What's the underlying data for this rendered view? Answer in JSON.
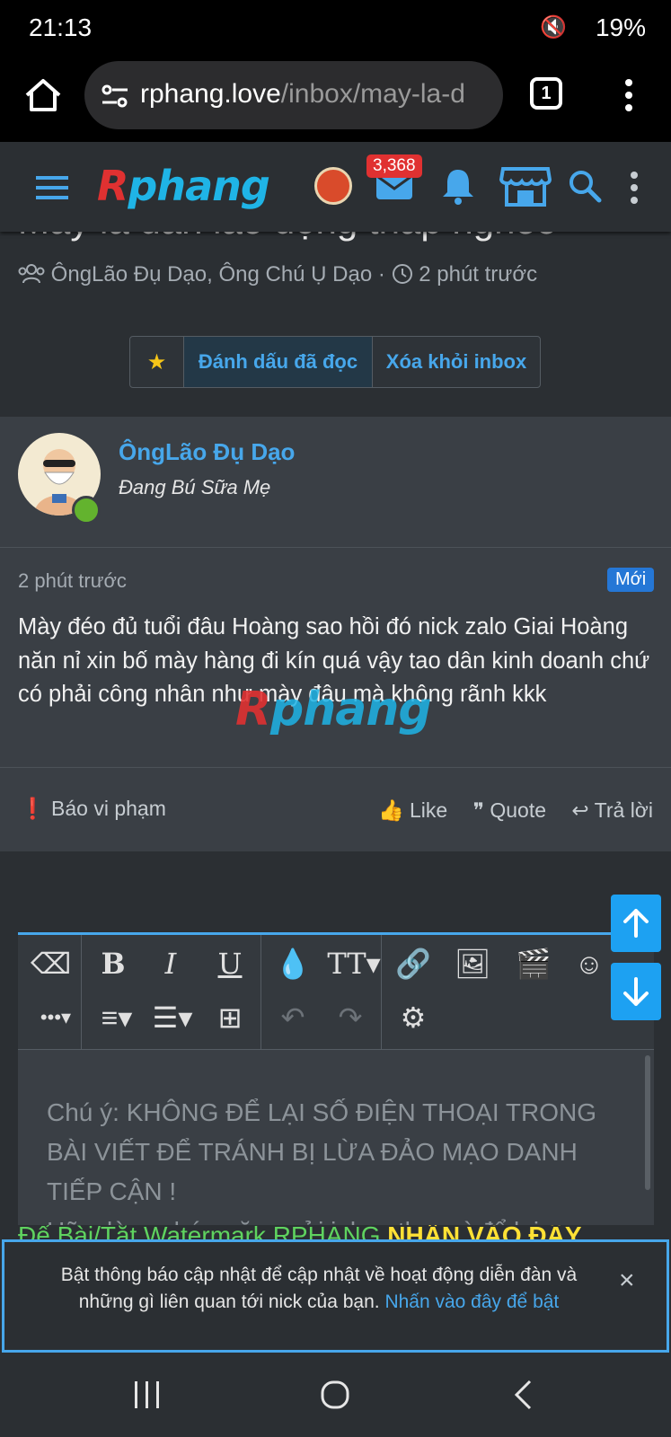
{
  "status": {
    "time": "21:13",
    "battery": "19%",
    "icons": [
      "mute-icon",
      "location-icon",
      "wifi-icon",
      "signal-icon",
      "volte-icon",
      "signal-icon"
    ]
  },
  "browser": {
    "url_domain": "rphang.love",
    "url_path": "/inbox/may-la-d",
    "tab_count": "1"
  },
  "header": {
    "logo": "Rphang",
    "inbox_badge": "3,368"
  },
  "thread": {
    "title": "Mày là dân lao động thấp nghèo",
    "participants": "ÔngLão Đụ Dạo, Ông Chú Ụ Dạo",
    "separator": "·",
    "time": "2 phút trước",
    "mark_read": "Đánh dấu đã đọc",
    "remove": "Xóa khỏi inbox"
  },
  "message": {
    "username": "ÔngLão Đụ Dạo",
    "user_title": "Đang Bú Sữa Mẹ",
    "time": "2 phút trước",
    "badge": "Mới",
    "text": "Mày đéo đủ tuổi đâu Hoàng sao hồi đó nick zalo Giai Hoàng năn nỉ xin bố mày hàng đi kín quá vậy tao dân kinh doanh chứ có phải công nhân như mày đâu mà không rãnh kkk",
    "watermark": "Rphang",
    "report": "Báo vi phạm",
    "like": "Like",
    "quote": "Quote",
    "reply": "Trả lời"
  },
  "editor": {
    "placeholder": "Chú ý: KHÔNG ĐỂ LẠI SỐ ĐIỆN THOẠI TRONG BÀI VIẾT ĐỂ TRÁNH BỊ LỪA ĐẢO MẠO DANH TIẾP CẬN !\nHãy dùng chức năng gửi inbox thay vì để lại",
    "strip_green": "Để Bài/Tắt Watermark RPHANG ",
    "strip_yellow": "NHẤN VÀO ĐÂY"
  },
  "notice": {
    "text": "Bật thông báo cập nhật để cập nhật về hoạt động diễn đàn và những gì liên quan tới nick của bạn. ",
    "link": "Nhấn vào đây để bật",
    "close": "×"
  }
}
